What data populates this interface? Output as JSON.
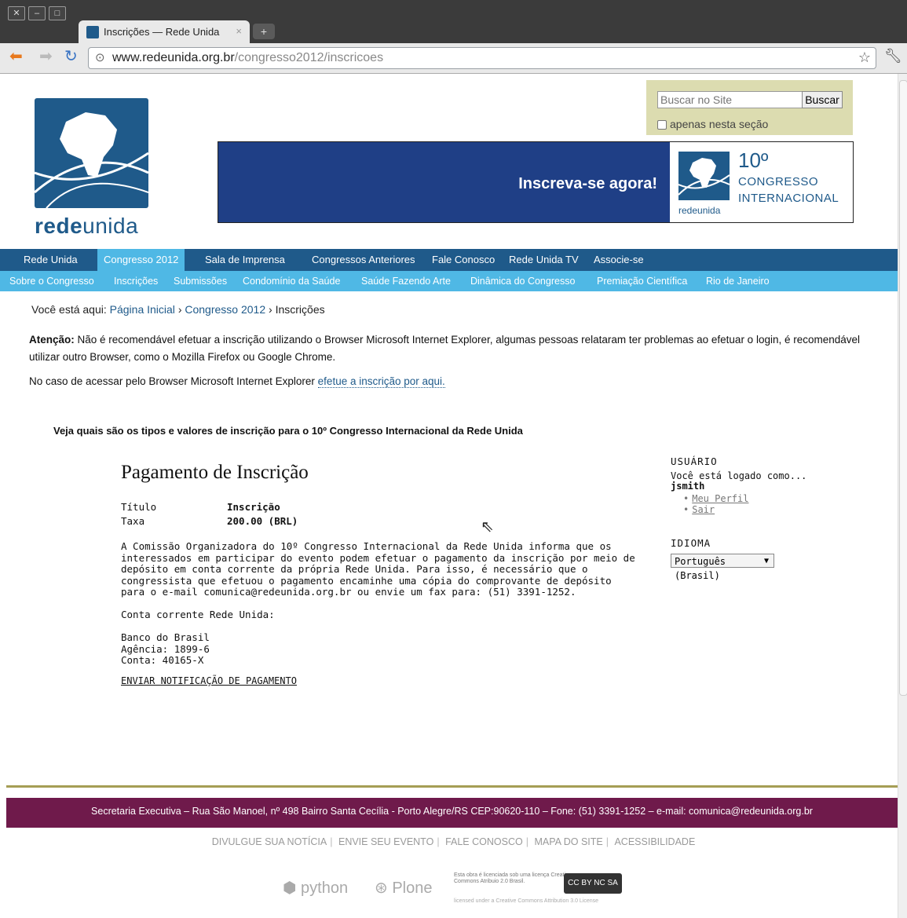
{
  "browser": {
    "tab_title": "Inscrições — Rede Unida",
    "tab_close": "×",
    "new_tab": "+",
    "url_domain": "www.redeunida.org.br",
    "url_path": "/congresso2012/inscricoes"
  },
  "header": {
    "logo_text_bold": "rede",
    "logo_text_rest": "unida",
    "search_placeholder": "Buscar no Site",
    "search_button": "Buscar",
    "search_option": "apenas nesta seção"
  },
  "banner": {
    "cta": "Inscreva-se agora!",
    "number": "10º",
    "line1": "CONGRESSO",
    "line2": "INTERNACIONAL",
    "logo_text": "redeunida"
  },
  "nav": {
    "primary": [
      "Rede Unida",
      "Congresso 2012",
      "Sala de Imprensa",
      "Congressos Anteriores",
      "Fale Conosco",
      "Rede Unida TV",
      "Associe-se"
    ],
    "secondary": [
      "Sobre o Congresso",
      "Inscrições",
      "Submissões",
      "Condomínio da Saúde",
      "Saúde Fazendo Arte",
      "Dinâmica do Congresso",
      "Premiação Científica",
      "Rio de Janeiro"
    ]
  },
  "breadcrumb": {
    "prefix": "Você está aqui:",
    "home": "Página Inicial",
    "sep": "›",
    "section": "Congresso 2012",
    "current": "Inscrições"
  },
  "notice": {
    "bold": "Atenção:",
    "text": " Não é recomendável efetuar a inscrição utilizando o Browser Microsoft Internet Explorer, algumas pessoas relataram ter problemas ao efetuar o login, é recomendável utilizar outro Browser, como o Mozilla Firefox ou Google Chrome.",
    "ie_text": "No caso de acessar pelo Browser Microsoft Internet Explorer ",
    "ie_link": "efetue a inscrição por aqui."
  },
  "tipos": "Veja quais são os tipos e valores de inscrição para o 10º Congresso Internacional da Rede Unida",
  "payment": {
    "title": "Pagamento de Inscrição",
    "label_title": "Título",
    "value_title": "Inscrição",
    "label_fee": "Taxa",
    "value_fee": "200.00 (BRL)",
    "paragraph": "A Comissão Organizadora do 10º Congresso Internacional da Rede Unida informa que os interessados em participar do evento podem efetuar o pagamento da inscrição por meio de depósito em conta corrente da própria Rede Unida. Para isso, é necessário que o congressista que efetuou o pagamento encaminhe uma cópia do comprovante de depósito para o e-mail comunica@redeunida.org.br ou envie um fax para: (51) 3391-1252.",
    "account_label": "Conta corrente Rede Unida:",
    "bank": "Banco do Brasil",
    "agency": "Agência: 1899-6",
    "account": "Conta: 40165-X",
    "send_link": "ENVIAR NOTIFICAÇÃO DE PAGAMENTO"
  },
  "sidebar": {
    "user_heading": "USUÁRIO",
    "logged_as": "Você está logado como...",
    "username": "jsmith",
    "links": [
      "Meu Perfil",
      "Sair"
    ],
    "lang_heading": "IDIOMA",
    "lang_selected": "Português (Brasil)"
  },
  "footer": {
    "address": "Secretaria Executiva – Rua São Manoel, nº 498 Bairro Santa Cecília - Porto Alegre/RS CEP:90620-110 – Fone: (51) 3391-1252 – e-mail: comunica@redeunida.org.br",
    "links": [
      "DIVULGUE SUA NOTÍCIA",
      "ENVIE SEU EVENTO",
      "FALE CONOSCO",
      "MAPA DO SITE",
      "ACESSIBILIDADE"
    ],
    "python": "python",
    "plone": "Plone",
    "cc_text": "Esta obra é licenciada sob uma licença Creative Commons Atribuio 2.0 Brasil.",
    "cc_badge": "CC BY NC SA",
    "cc_sub": "licensed under a Creative Commons Attribution 3.0 License"
  }
}
